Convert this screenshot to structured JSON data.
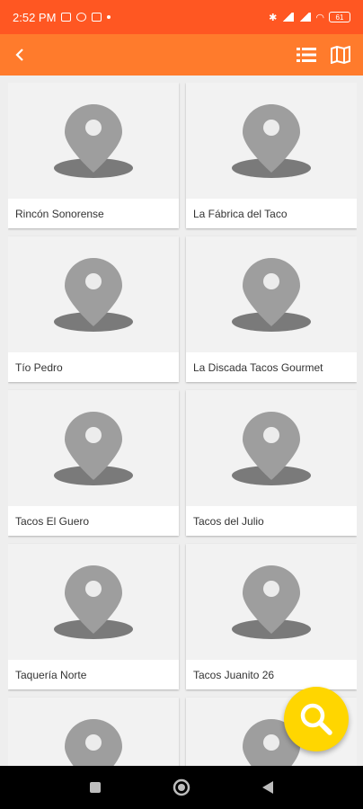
{
  "status_bar": {
    "time": "2:52 PM",
    "battery": "61"
  },
  "colors": {
    "status_bar": "#ff5722",
    "app_bar": "#ff7b2c",
    "fab": "#ffd600",
    "pin": "#9e9e9e",
    "pin_shadow": "#7a7a7a"
  },
  "app_bar": {
    "back_icon": "back-arrow-icon",
    "list_icon": "list-view-icon",
    "map_icon": "map-icon"
  },
  "places": [
    {
      "name": "Rincón Sonorense"
    },
    {
      "name": "La Fábrica del Taco"
    },
    {
      "name": "Tío Pedro"
    },
    {
      "name": "La Discada Tacos Gourmet"
    },
    {
      "name": "Tacos El Guero"
    },
    {
      "name": "Tacos del Julio"
    },
    {
      "name": "Taquería Norte"
    },
    {
      "name": "Tacos Juanito 26"
    },
    {
      "name": ""
    },
    {
      "name": ""
    }
  ],
  "fab": {
    "icon": "search-icon"
  },
  "nav": {
    "buttons": [
      "recents-square-icon",
      "home-circle-icon",
      "back-triangle-icon"
    ]
  }
}
